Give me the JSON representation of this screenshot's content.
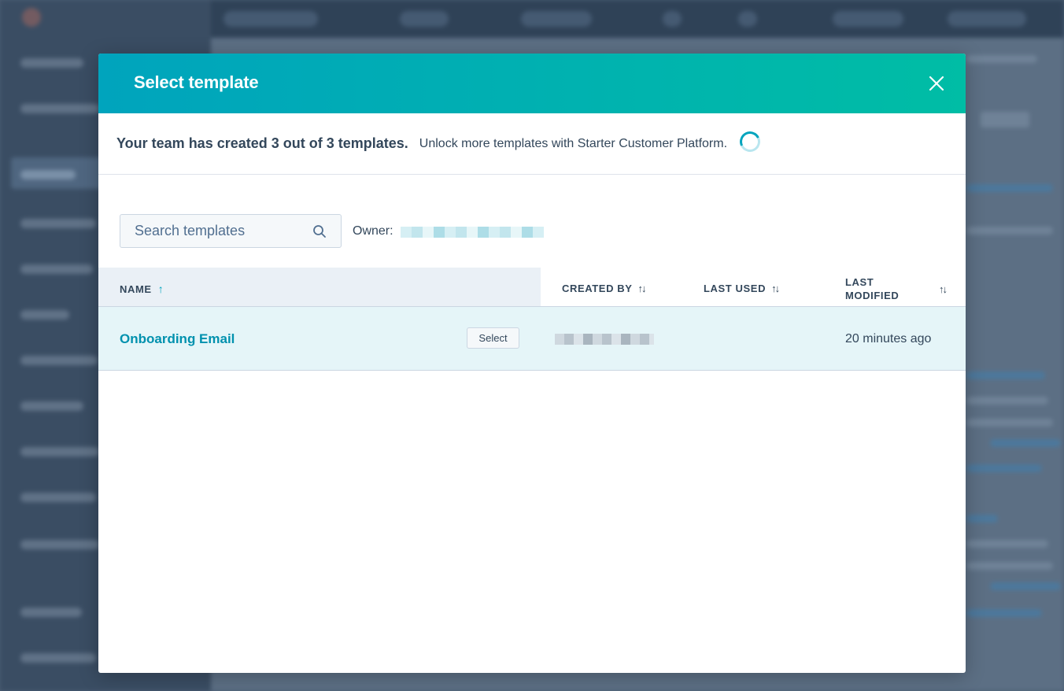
{
  "modal": {
    "title": "Select template",
    "close_icon": "close-icon",
    "limit_message": "Your team has created 3 out of 3 templates.",
    "upgrade_message": "Unlock more templates with Starter Customer Platform."
  },
  "toolbar": {
    "search_placeholder": "Search templates",
    "search_icon": "search-icon",
    "owner_label": "Owner:"
  },
  "table": {
    "columns": [
      {
        "label": "NAME",
        "sort": "ascending"
      },
      {
        "label": "CREATED BY",
        "sort": "none"
      },
      {
        "label": "LAST USED",
        "sort": "none"
      },
      {
        "label": "LAST\nMODIFIED",
        "sort": "none"
      }
    ],
    "sort_up_glyph": "↑",
    "sort_both_glyph": "↑↓",
    "rows": [
      {
        "name": "Onboarding Email",
        "select_label": "Select",
        "last_modified": "20 minutes ago"
      }
    ]
  },
  "colors": {
    "header_gradient_start": "#00a4bd",
    "header_gradient_end": "#00bda5",
    "link": "#0091ae",
    "text": "#33475b",
    "row_highlight": "#e5f5f8"
  }
}
